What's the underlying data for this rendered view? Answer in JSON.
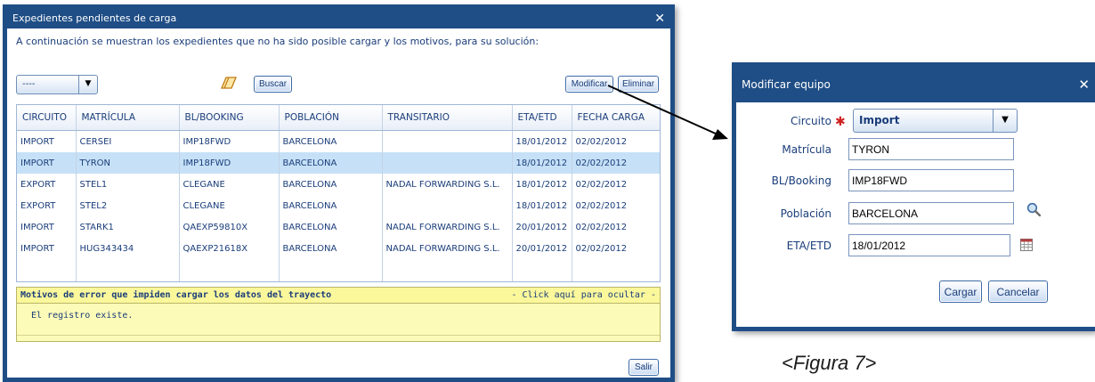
{
  "left_dialog": {
    "title": "Expedientes pendientes de carga",
    "intro": "A continuación se muestran los expedientes que no ha sido posible cargar y los motivos, para su solución:",
    "filter_value": "----",
    "buscar": "Buscar",
    "modificar": "Modificar",
    "eliminar": "Eliminar",
    "columns": [
      "CIRCUITO",
      "MATRÍCULA",
      "BL/BOOKING",
      "POBLACIÓN",
      "TRANSITARIO",
      "ETA/ETD",
      "FECHA CARGA"
    ],
    "rows": [
      [
        "IMPORT",
        "CERSEI",
        "IMP18FWD",
        "BARCELONA",
        "",
        "18/01/2012",
        "02/02/2012"
      ],
      [
        "IMPORT",
        "TYRON",
        "IMP18FWD",
        "BARCELONA",
        "",
        "18/01/2012",
        "02/02/2012"
      ],
      [
        "EXPORT",
        "STEL1",
        "CLEGANE",
        "BARCELONA",
        "NADAL FORWARDING S.L.",
        "18/01/2012",
        "02/02/2012"
      ],
      [
        "EXPORT",
        "STEL2",
        "CLEGANE",
        "BARCELONA",
        "",
        "18/01/2012",
        "02/02/2012"
      ],
      [
        "IMPORT",
        "STARK1",
        "QAEXP59810X",
        "BARCELONA",
        "NADAL FORWARDING S.L.",
        "20/01/2012",
        "02/02/2012"
      ],
      [
        "IMPORT",
        "HUG343434",
        "QAEXP21618X",
        "BARCELONA",
        "NADAL FORWARDING S.L.",
        "20/01/2012",
        "02/02/2012"
      ]
    ],
    "error_title": "Motivos de error que impiden cargar los datos del trayecto",
    "error_toggle": "- Click aquí para ocultar -",
    "error_message": "El registro existe.",
    "salir": "Salir"
  },
  "right_dialog": {
    "title": "Modificar equipo",
    "labels": {
      "circuito": "Circuito",
      "matricula": "Matrícula",
      "booking": "BL/Booking",
      "poblacion": "Población",
      "eta": "ETA/ETD"
    },
    "values": {
      "circuito": "Import",
      "matricula": "TYRON",
      "booking": "IMP18FWD",
      "poblacion": "BARCELONA",
      "eta": "18/01/2012"
    },
    "cargar": "Cargar",
    "cancelar": "Cancelar"
  },
  "caption": "<Figura 7>"
}
